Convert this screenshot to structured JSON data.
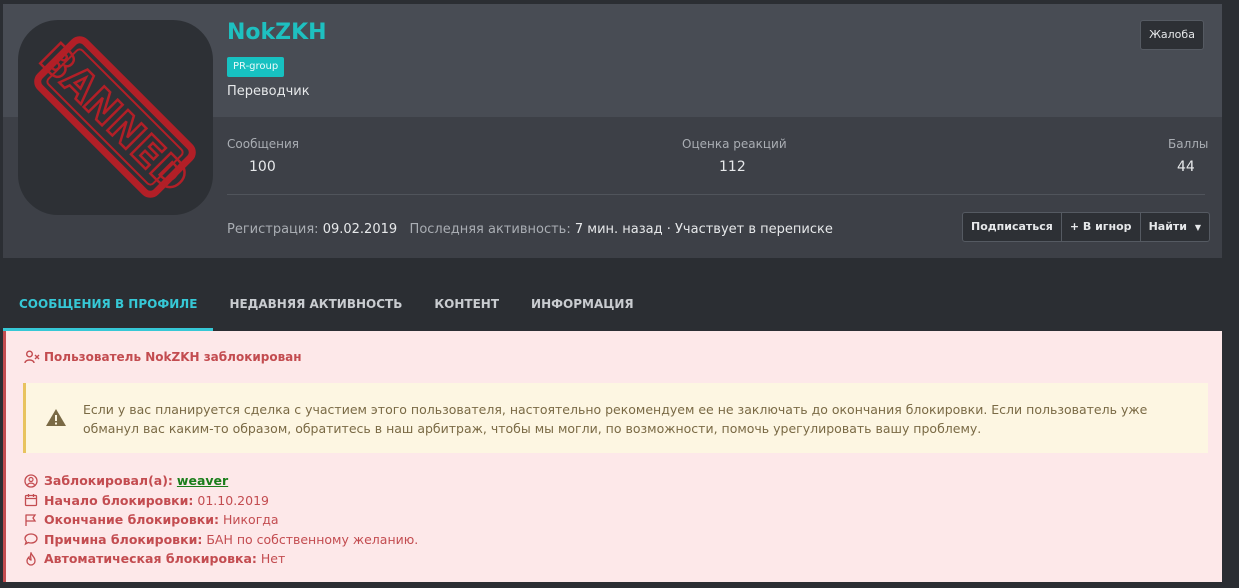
{
  "profile": {
    "username": "NokZKH",
    "group_badge": "PR-group",
    "user_title": "Переводчик",
    "avatar_stamp_text": "BANNED",
    "report_label": "Жалоба"
  },
  "stats": [
    {
      "label": "Сообщения",
      "value": "100"
    },
    {
      "label": "Оценка реакций",
      "value": "112"
    },
    {
      "label": "Баллы",
      "value": "44"
    }
  ],
  "meta": {
    "registered_label": "Регистрация:",
    "registered_value": "09.02.2019",
    "last_active_label": "Последняя активность:",
    "last_active_value": "7 мин. назад · Участвует в переписке"
  },
  "actions": {
    "follow": "Подписаться",
    "ignore": "+ В игнор",
    "find": "Найти"
  },
  "tabs": [
    {
      "label": "Сообщения в профиле",
      "active": true
    },
    {
      "label": "Недавняя активность",
      "active": false
    },
    {
      "label": "Контент",
      "active": false
    },
    {
      "label": "Информация",
      "active": false
    }
  ],
  "ban": {
    "title": "Пользователь NokZKH заблокирован",
    "warning": "Если у вас планируется сделка с участием этого пользователя, настоятельно рекомендуем ее не заключать до окончания блокировки. Если пользователь уже обманул вас каким-то образом, обратитесь в наш арбитраж, чтобы мы могли, по возможности, помочь урегулировать вашу проблему.",
    "details": {
      "banned_by_label": "Заблокировал(а):",
      "banned_by_value": "weaver",
      "start_label": "Начало блокировки:",
      "start_value": "01.10.2019",
      "end_label": "Окончание блокировки:",
      "end_value": "Никогда",
      "reason_label": "Причина блокировки:",
      "reason_value": "БАН по собственному желанию.",
      "auto_label": "Автоматическая блокировка:",
      "auto_value": "Нет"
    }
  },
  "colors": {
    "accent": "#1ec0c0",
    "ban_red": "#c34c50",
    "ban_bg": "#fde8e9",
    "warn_bg": "#fdf6e2",
    "link_green": "#1b7e1b"
  }
}
